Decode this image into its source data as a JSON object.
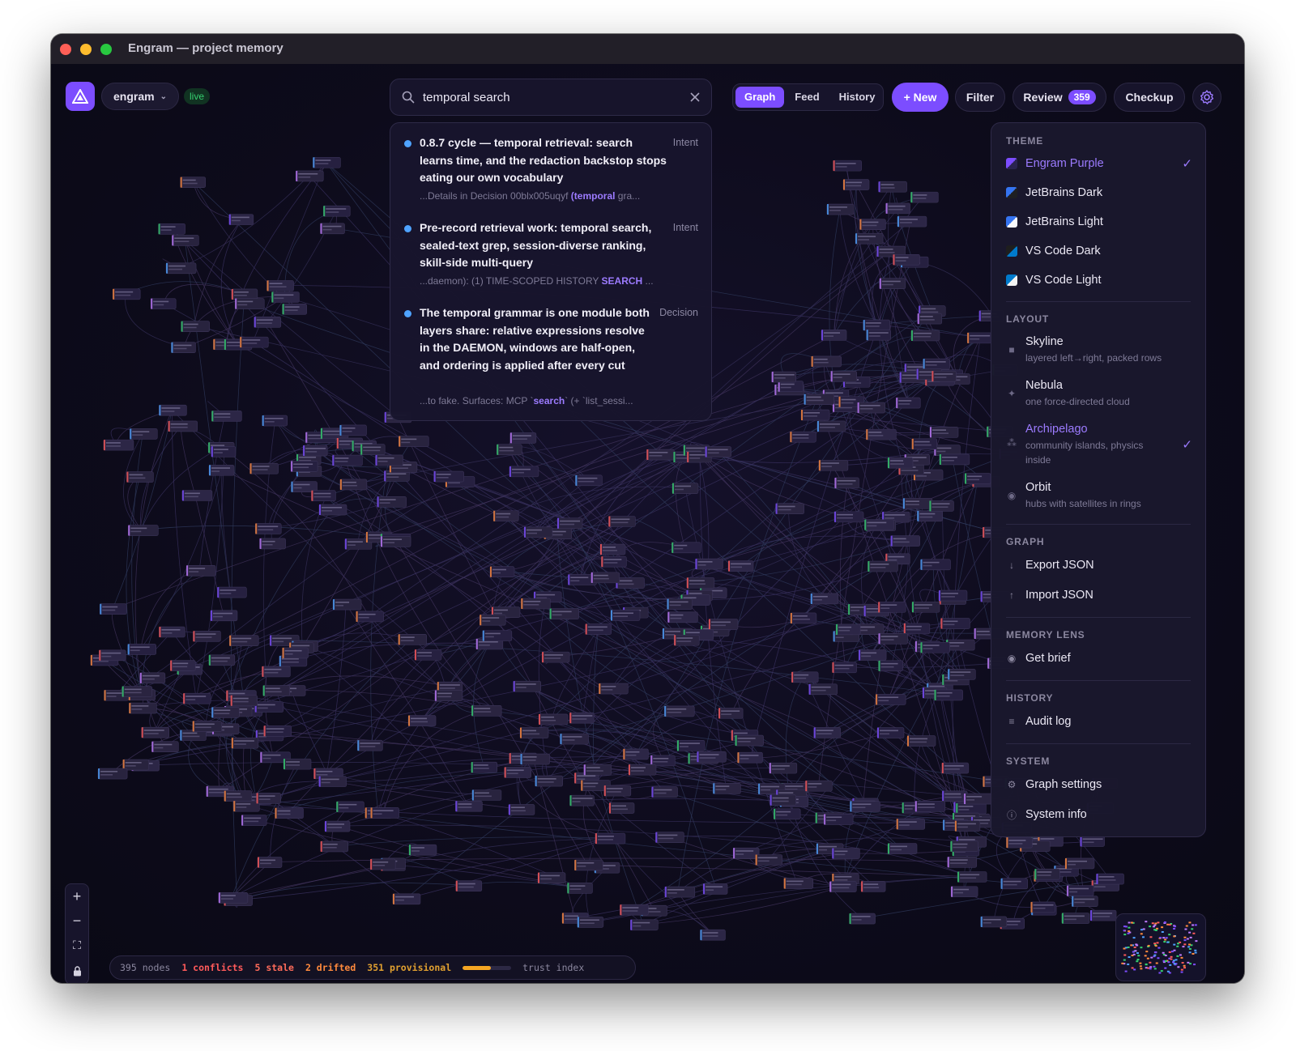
{
  "window": {
    "title": "Engram — project memory"
  },
  "header": {
    "project": "engram",
    "live_label": "live",
    "search": {
      "value": "temporal search"
    },
    "view_tabs": [
      {
        "label": "Graph",
        "active": true
      },
      {
        "label": "Feed",
        "active": false
      },
      {
        "label": "History",
        "active": false
      }
    ],
    "new_label": "+ New",
    "filter_label": "Filter",
    "review_label": "Review",
    "review_count": "359",
    "checkup_label": "Checkup"
  },
  "results": [
    {
      "title": "0.8.7 cycle — temporal retrieval: search learns time, and the redaction backstop stops eating our own vocabulary",
      "kind": "Intent",
      "snippet_pre": "...Details in Decision 00blx005uqyf ",
      "snippet_hl": "(temporal",
      "snippet_post": " gra..."
    },
    {
      "title": "Pre-record retrieval work: temporal search, sealed-text grep, session-diverse ranking, skill-side multi-query",
      "kind": "Intent",
      "snippet_pre": "...daemon): (1) TIME-SCOPED HISTORY ",
      "snippet_hl": "SEARCH",
      "snippet_post": " ..."
    },
    {
      "title": "The temporal grammar is one module both layers share: relative expressions resolve in the DAEMON, windows are half-open, and ordering is applied after every cut",
      "kind": "Decision",
      "snippet_pre": "...to fake. Surfaces: MCP `",
      "snippet_hl": "search",
      "snippet_post": "` (+ `list_sessi..."
    }
  ],
  "panel": {
    "theme_title": "THEME",
    "themes": [
      {
        "label": "Engram Purple",
        "selected": true,
        "swatch": "#7c4dff"
      },
      {
        "label": "JetBrains Dark",
        "selected": false,
        "swatch": "#3574f0"
      },
      {
        "label": "JetBrains Light",
        "selected": false,
        "swatch": "#dfe1e5"
      },
      {
        "label": "VS Code Dark",
        "selected": false,
        "swatch": "#007acc"
      },
      {
        "label": "VS Code Light",
        "selected": false,
        "swatch": "#f3f3f3"
      }
    ],
    "layout_title": "LAYOUT",
    "layouts": [
      {
        "label": "Skyline",
        "desc": "layered left→right, packed rows",
        "icon": "square-icon",
        "selected": false
      },
      {
        "label": "Nebula",
        "desc": "one force-directed cloud",
        "icon": "sparkle-icon",
        "selected": false
      },
      {
        "label": "Archipelago",
        "desc": "community islands, physics inside",
        "icon": "islands-icon",
        "selected": true
      },
      {
        "label": "Orbit",
        "desc": "hubs with satellites in rings",
        "icon": "orbit-icon",
        "selected": false
      }
    ],
    "graph_title": "GRAPH",
    "export_label": "Export JSON",
    "import_label": "Import JSON",
    "lens_title": "MEMORY LENS",
    "brief_label": "Get brief",
    "history_title": "HISTORY",
    "audit_label": "Audit log",
    "system_title": "SYSTEM",
    "graph_settings_label": "Graph settings",
    "system_info_label": "System info"
  },
  "status": {
    "nodes": "395 nodes",
    "conflicts": "1 conflicts",
    "stale": "5 stale",
    "drifted": "2 drifted",
    "provisional": "351 provisional",
    "trust_label": "trust index",
    "trust_value": 0.58
  },
  "colors": {
    "accent": "#7c4dff",
    "danger": "#ff5a5a",
    "warning": "#ff8a3d",
    "amber": "#e0a030",
    "live": "#35d06f"
  }
}
